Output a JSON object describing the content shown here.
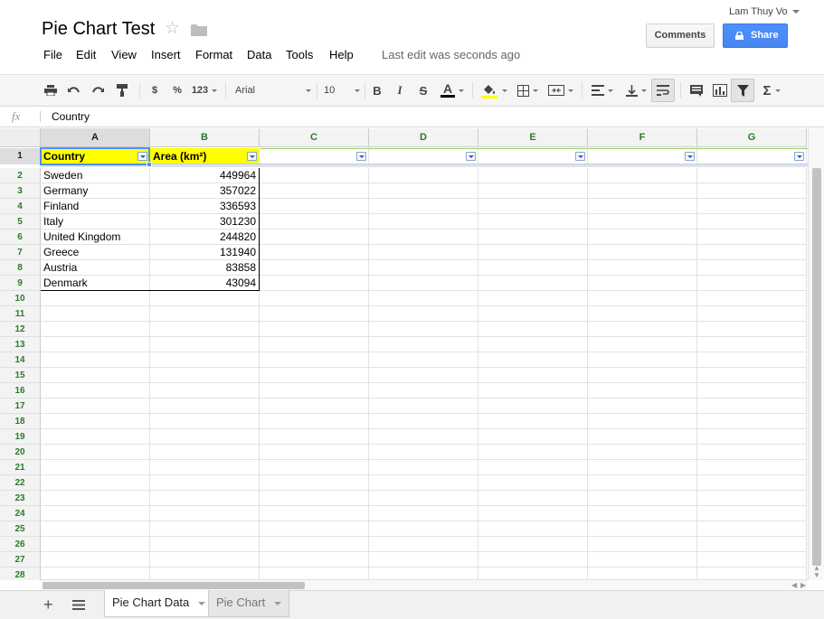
{
  "header": {
    "title": "Pie Chart Test",
    "user": "Lam Thuy Vo",
    "comments_label": "Comments",
    "share_label": "Share",
    "last_edit": "Last edit was seconds ago",
    "menus": [
      "File",
      "Edit",
      "View",
      "Insert",
      "Format",
      "Data",
      "Tools",
      "Help"
    ]
  },
  "toolbar": {
    "currency": "$",
    "percent": "%",
    "number_format": "123",
    "font": "Arial",
    "font_size": "10",
    "bold": "B",
    "italic": "I",
    "strike": "S",
    "text_color_letter": "A",
    "functions": "Σ",
    "accent_text_color": "#000000",
    "accent_fill_color": "#ffff00"
  },
  "formula_bar": {
    "fx": "fx",
    "value": "Country"
  },
  "columns": [
    "A",
    "B",
    "C",
    "D",
    "E",
    "F",
    "G"
  ],
  "rows": [
    "1",
    "2",
    "3",
    "4",
    "5",
    "6",
    "7",
    "8",
    "9",
    "10",
    "11",
    "12",
    "13",
    "14",
    "15",
    "16",
    "17",
    "18",
    "19",
    "20",
    "21",
    "22",
    "23",
    "24",
    "25",
    "26",
    "27",
    "28"
  ],
  "table": {
    "headers": [
      "Country",
      "Area (km²)"
    ],
    "data": [
      [
        "Sweden",
        "449964"
      ],
      [
        "Germany",
        "357022"
      ],
      [
        "Finland",
        "336593"
      ],
      [
        "Italy",
        "301230"
      ],
      [
        "United Kingdom",
        "244820"
      ],
      [
        "Greece",
        "131940"
      ],
      [
        "Austria",
        "83858"
      ],
      [
        "Denmark",
        "43094"
      ]
    ]
  },
  "sheets": [
    {
      "name": "Pie Chart Data",
      "active": true
    },
    {
      "name": "Pie Chart",
      "active": false
    }
  ],
  "colors": {
    "share_button": "#4d90fe",
    "header_fill": "#ffff00",
    "selection": "#4d90fe",
    "row_col_header_text": "#2a7a2a"
  }
}
